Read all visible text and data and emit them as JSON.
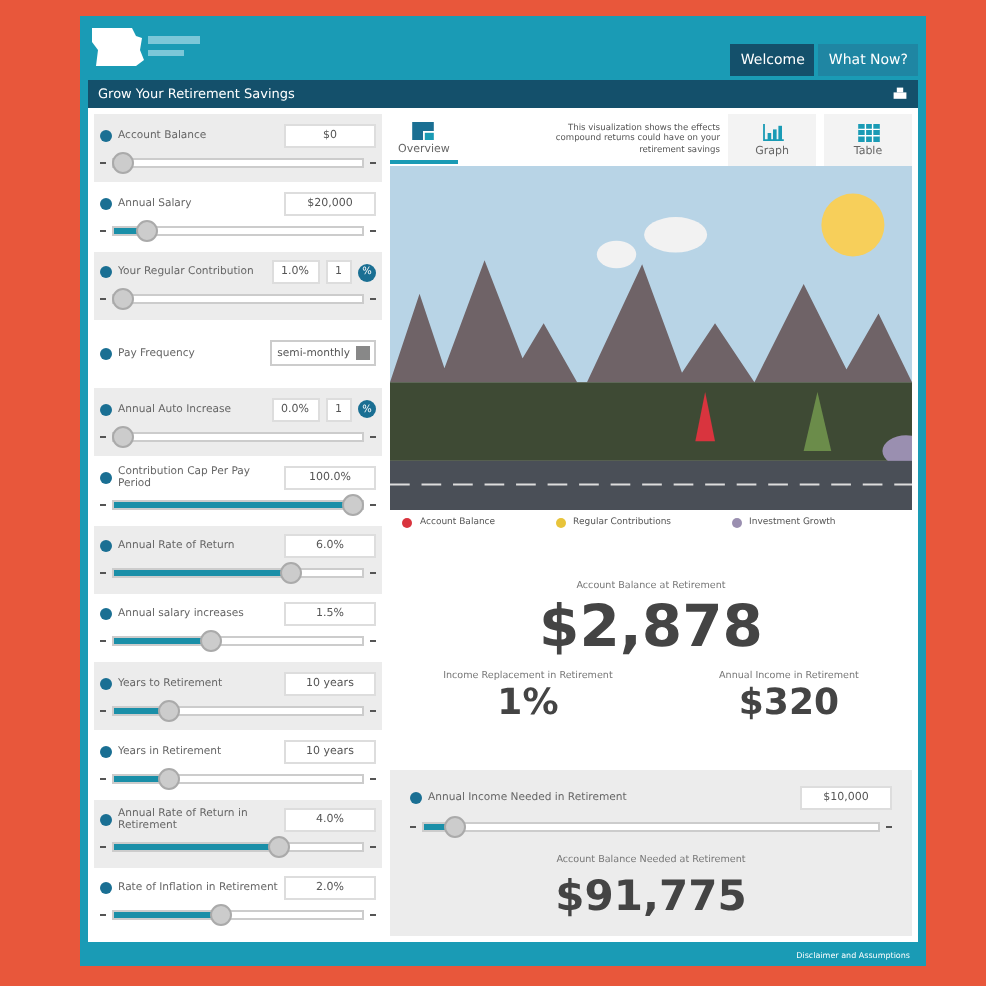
{
  "header": {
    "nav": [
      {
        "label": "Welcome",
        "selected": true
      },
      {
        "label": "What Now?",
        "selected": false
      }
    ]
  },
  "title_bar": {
    "title": "Grow Your Retirement Savings"
  },
  "inputs": [
    {
      "kind": "slider",
      "label": "Account Balance",
      "value": "$0",
      "level": 0
    },
    {
      "kind": "slider",
      "label": "Annual Salary",
      "value": "$20,000",
      "level": 0.1
    },
    {
      "kind": "slider",
      "label": "Your Regular Contribution",
      "value": "1.0%",
      "step": "1",
      "unit": "%",
      "level": 0
    },
    {
      "kind": "dropdown",
      "label": "Pay Frequency",
      "value": "semi-monthly"
    },
    {
      "kind": "slider",
      "label": "Annual Auto Increase",
      "value": "0.0%",
      "step": "1",
      "unit": "%",
      "level": 0
    },
    {
      "kind": "slider",
      "label": "Contribution Cap Per Pay Period",
      "value": "100.0%",
      "level": 1
    },
    {
      "kind": "slider",
      "label": "Annual Rate of Return",
      "value": "6.0%",
      "level": 0.73
    },
    {
      "kind": "slider",
      "label": "Annual salary increases",
      "value": "1.5%",
      "level": 0.38
    },
    {
      "kind": "slider",
      "label": "Years to Retirement",
      "value": "10 years",
      "level": 0.2
    },
    {
      "kind": "slider",
      "label": "Years in Retirement",
      "value": "10 years",
      "level": 0.2
    },
    {
      "kind": "slider",
      "label": "Annual Rate of Return in Retirement",
      "value": "4.0%",
      "level": 0.68
    },
    {
      "kind": "slider",
      "label": "Rate of Inflation in Retirement",
      "value": "2.0%",
      "level": 0.43
    }
  ],
  "view_tabs": [
    {
      "label": "Overview",
      "selected": true
    },
    {
      "label": "Graph",
      "selected": false
    },
    {
      "label": "Table",
      "selected": false
    }
  ],
  "description": "This visualization shows the effects compound returns could have on your retirement savings",
  "legend": [
    {
      "label": "Account Balance",
      "color": "#d9343e"
    },
    {
      "label": "Regular Contributions",
      "color": "#e8c43a"
    },
    {
      "label": "Investment Growth",
      "color": "#9a8fb0"
    }
  ],
  "results": {
    "main_label": "Account Balance at Retirement",
    "main_value": "$2,878",
    "stats": [
      {
        "label": "Income Replacement in Retirement",
        "value": "1%"
      },
      {
        "label": "Annual Income in Retirement",
        "value": "$320"
      }
    ]
  },
  "needed": {
    "label": "Annual Income Needed in Retirement",
    "value": "$10,000",
    "level": 0.05,
    "result_label": "Account Balance Needed at Retirement",
    "result_value": "$91,775"
  },
  "footer": {
    "link": "Disclaimer and Assumptions"
  }
}
